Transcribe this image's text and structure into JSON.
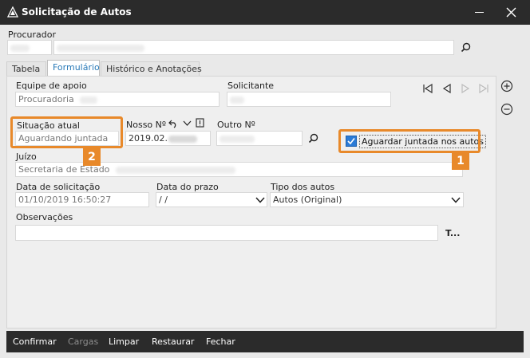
{
  "window": {
    "title": "Solicitação de Autos"
  },
  "procurador": {
    "label": "Procurador"
  },
  "tabs": [
    {
      "label": "Tabela"
    },
    {
      "label": "Formulário"
    },
    {
      "label": "Histórico e Anotações"
    }
  ],
  "form": {
    "equipe_label": "Equipe de apoio",
    "equipe_value": "Procuradoria",
    "solicitante_label": "Solicitante",
    "situacao_label": "Situação atual",
    "situacao_value": "Aguardando juntada",
    "nosso_label": "Nosso Nº",
    "nosso_value": "2019.02.",
    "outro_label": "Outro Nº",
    "aguardar_label": "Aguardar juntada nos autos",
    "aguardar_checked": true,
    "juizo_label": "Juízo",
    "juizo_value": "Secretaria de Estado",
    "data_solicitacao_label": "Data de solicitação",
    "data_solicitacao_value": "01/10/2019 16:50:27",
    "data_prazo_label": "Data do prazo",
    "data_prazo_value": " /  /",
    "tipo_label": "Tipo dos autos",
    "tipo_value": "Autos (Original)",
    "observacoes_label": "Observações",
    "text_tool_label": "T..."
  },
  "callouts": {
    "badge1": "1",
    "badge2": "2",
    "color": "#e8892a"
  },
  "footer": {
    "confirmar": "Confirmar",
    "cargas": "Cargas",
    "limpar": "Limpar",
    "restaurar": "Restaurar",
    "fechar": "Fechar"
  },
  "colors": {
    "titlebar": "#2b2b2b",
    "accent": "#2b7bd6",
    "tab_active_text": "#2a7ab8"
  }
}
